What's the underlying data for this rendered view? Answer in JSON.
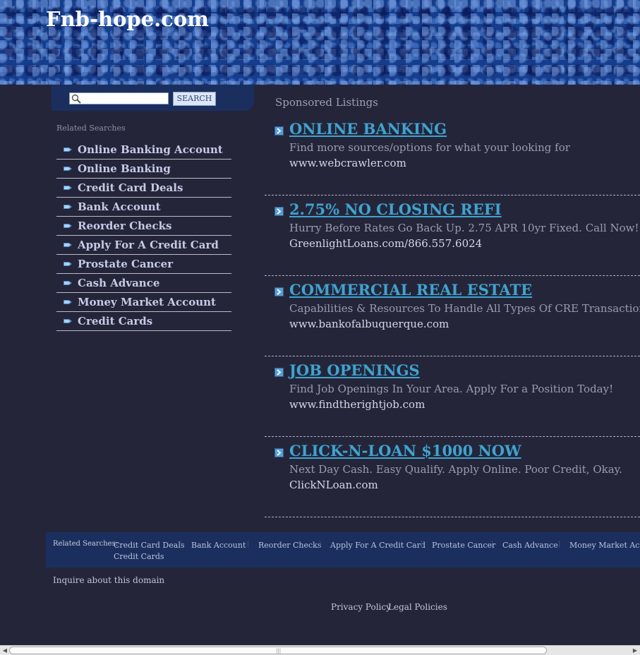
{
  "site_title": "Fnb-hope.com",
  "search": {
    "placeholder": "",
    "value": "",
    "button_label": "SEARCH"
  },
  "sidebar": {
    "heading": "Related Searches",
    "items": [
      {
        "label": "Online Banking Account"
      },
      {
        "label": "Online Banking"
      },
      {
        "label": "Credit Card Deals"
      },
      {
        "label": "Bank Account"
      },
      {
        "label": "Reorder Checks"
      },
      {
        "label": "Apply For A Credit Card"
      },
      {
        "label": "Prostate Cancer"
      },
      {
        "label": "Cash Advance"
      },
      {
        "label": "Money Market Account"
      },
      {
        "label": "Credit Cards"
      }
    ]
  },
  "sponsored": {
    "heading": "Sponsored Listings",
    "listings": [
      {
        "title": "ONLINE BANKING",
        "description": "Find more sources/options for what your looking for",
        "url": "www.webcrawler.com"
      },
      {
        "title": "2.75% NO CLOSING REFI",
        "description": "Hurry Before Rates Go Back Up. 2.75 APR 10yr Fixed. Call Now!",
        "url": "GreenlightLoans.com/866.557.6024"
      },
      {
        "title": "COMMERCIAL REAL ESTATE",
        "description": "Capabilities & Resources To Handle All Types Of CRE Transactions",
        "url": "www.bankofalbuquerque.com"
      },
      {
        "title": "JOB OPENINGS",
        "description": "Find Job Openings In Your Area. Apply For a Position Today!",
        "url": "www.findtherightjob.com"
      },
      {
        "title": "CLICK-N-LOAN $1000 NOW",
        "description": "Next Day Cash. Easy Qualify. Apply Online. Poor Credit, Okay.",
        "url": "ClickNLoan.com"
      }
    ]
  },
  "footer": {
    "related_label": "Related Searches:",
    "links": [
      {
        "label": "Credit Card Deals"
      },
      {
        "label": "Bank Account"
      },
      {
        "label": "Reorder Checks"
      },
      {
        "label": "Apply For A Credit Card"
      },
      {
        "label": "Prostate Cancer"
      },
      {
        "label": "Cash Advance"
      },
      {
        "label": "Money Market Account"
      },
      {
        "label": "Credit Cards"
      }
    ],
    "inquire": "Inquire about this domain",
    "privacy": "Privacy Policy",
    "legal": "Legal Policies"
  },
  "scrollbar": {
    "left_arrow": "◀",
    "right_arrow": "▶",
    "grip": "|||"
  },
  "colors": {
    "page_bg": "#25253a",
    "header_blue": "#153d8c",
    "panel_blue": "#1a2f5e",
    "listing_title": "#3ea4cf"
  },
  "icons": {
    "search": "magnifier-icon",
    "sidebar_bullet": "arrow-bullet-icon",
    "listing_bullet": "chevron-right-box-icon"
  }
}
